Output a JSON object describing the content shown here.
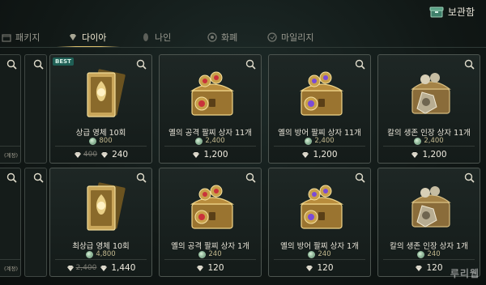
{
  "header": {
    "storage_label": "보관함",
    "tabs": [
      {
        "label": "패키지",
        "active": false
      },
      {
        "label": "다이아",
        "active": true
      },
      {
        "label": "나인",
        "active": false
      },
      {
        "label": "화폐",
        "active": false
      },
      {
        "label": "마일리지",
        "active": false
      }
    ]
  },
  "left_column": {
    "notes": [
      "(계정)",
      "(계정)"
    ]
  },
  "cards": [
    {
      "name": "상급 영체 10회",
      "badge": "BEST",
      "bonus": "800",
      "old_price": "400",
      "price": "240",
      "art": "card"
    },
    {
      "name": "옐의 공격 팔찌 상자 11개",
      "badge": "",
      "bonus": "2,400",
      "old_price": "",
      "price": "1,200",
      "art": "chest-red"
    },
    {
      "name": "옐의 방어 팔찌 상자 11개",
      "badge": "",
      "bonus": "2,400",
      "old_price": "",
      "price": "1,200",
      "art": "chest-purple"
    },
    {
      "name": "칼의 생존 인장 상자 11개",
      "badge": "",
      "bonus": "2,400",
      "old_price": "",
      "price": "1,200",
      "art": "chest-seal"
    },
    {
      "name": "최상급 영체 10회",
      "badge": "",
      "bonus": "4,800",
      "old_price": "2,400",
      "price": "1,440",
      "art": "card"
    },
    {
      "name": "옐의 공격 팔찌 상자 1개",
      "badge": "",
      "bonus": "240",
      "old_price": "",
      "price": "120",
      "art": "chest-red"
    },
    {
      "name": "옐의 방어 팔찌 상자 1개",
      "badge": "",
      "bonus": "240",
      "old_price": "",
      "price": "120",
      "art": "chest-purple"
    },
    {
      "name": "칼의 생존 인장 상자 1개",
      "badge": "",
      "bonus": "240",
      "old_price": "",
      "price": "120",
      "art": "chest-seal"
    }
  ],
  "watermark": "루리웹",
  "colors": {
    "accent": "#d9bd6a",
    "best_badge": "#1f5f55",
    "bonus_coin": "#5f8f6d"
  }
}
